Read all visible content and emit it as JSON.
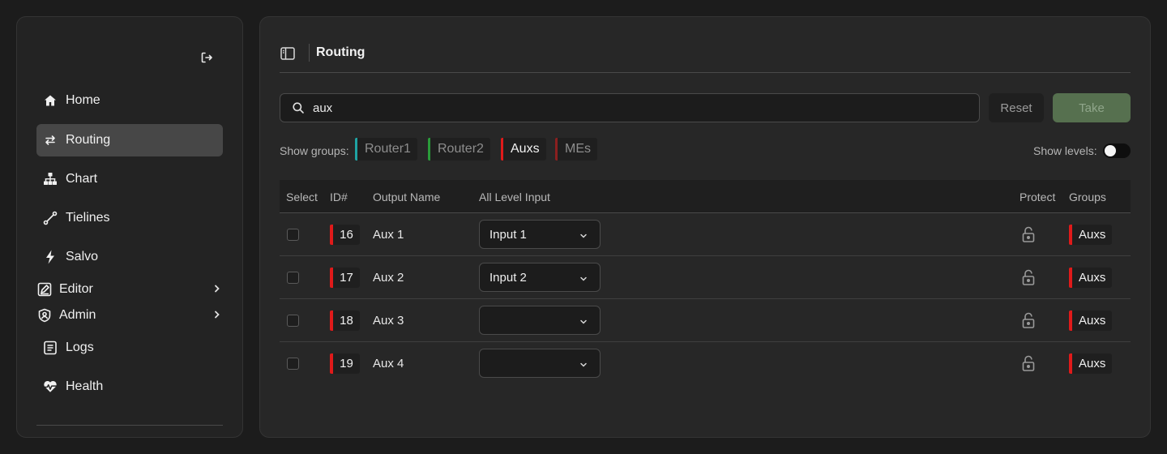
{
  "sidebar": {
    "items": [
      {
        "label": "Home",
        "icon": "home-icon"
      },
      {
        "label": "Routing",
        "icon": "swap-arrows-icon",
        "active": true
      },
      {
        "label": "Chart",
        "icon": "hierarchy-icon"
      },
      {
        "label": "Tielines",
        "icon": "link-line-icon"
      },
      {
        "label": "Salvo",
        "icon": "lightning-icon"
      },
      {
        "label": "Editor",
        "icon": "edit-square-icon",
        "expandable": true
      },
      {
        "label": "Admin",
        "icon": "shield-user-icon",
        "expandable": true
      },
      {
        "label": "Logs",
        "icon": "document-list-icon"
      },
      {
        "label": "Health",
        "icon": "heart-pulse-icon"
      }
    ]
  },
  "header": {
    "title": "Routing"
  },
  "search": {
    "value": "aux"
  },
  "actions": {
    "reset": "Reset",
    "take": "Take"
  },
  "groups": {
    "label": "Show groups:",
    "chips": [
      {
        "label": "Router1",
        "color": "#1fa3a3",
        "active": false
      },
      {
        "label": "Router2",
        "color": "#2a9b3a",
        "active": false
      },
      {
        "label": "Auxs",
        "color": "#e01a1a",
        "active": true
      },
      {
        "label": "MEs",
        "color": "#8a1f1f",
        "active": false
      }
    ]
  },
  "levels": {
    "label": "Show levels:",
    "enabled": false
  },
  "table": {
    "columns": [
      "Select",
      "ID#",
      "Output Name",
      "All Level Input",
      "Protect",
      "Groups"
    ],
    "rows": [
      {
        "id": "16",
        "name": "Aux 1",
        "input": "Input 1",
        "group": "Auxs"
      },
      {
        "id": "17",
        "name": "Aux 2",
        "input": "Input 2",
        "group": "Auxs"
      },
      {
        "id": "18",
        "name": "Aux 3",
        "input": "",
        "group": "Auxs"
      },
      {
        "id": "19",
        "name": "Aux 4",
        "input": "",
        "group": "Auxs"
      }
    ]
  },
  "colors": {
    "accent_red": "#e01a1a",
    "take_green": "#56704f"
  }
}
